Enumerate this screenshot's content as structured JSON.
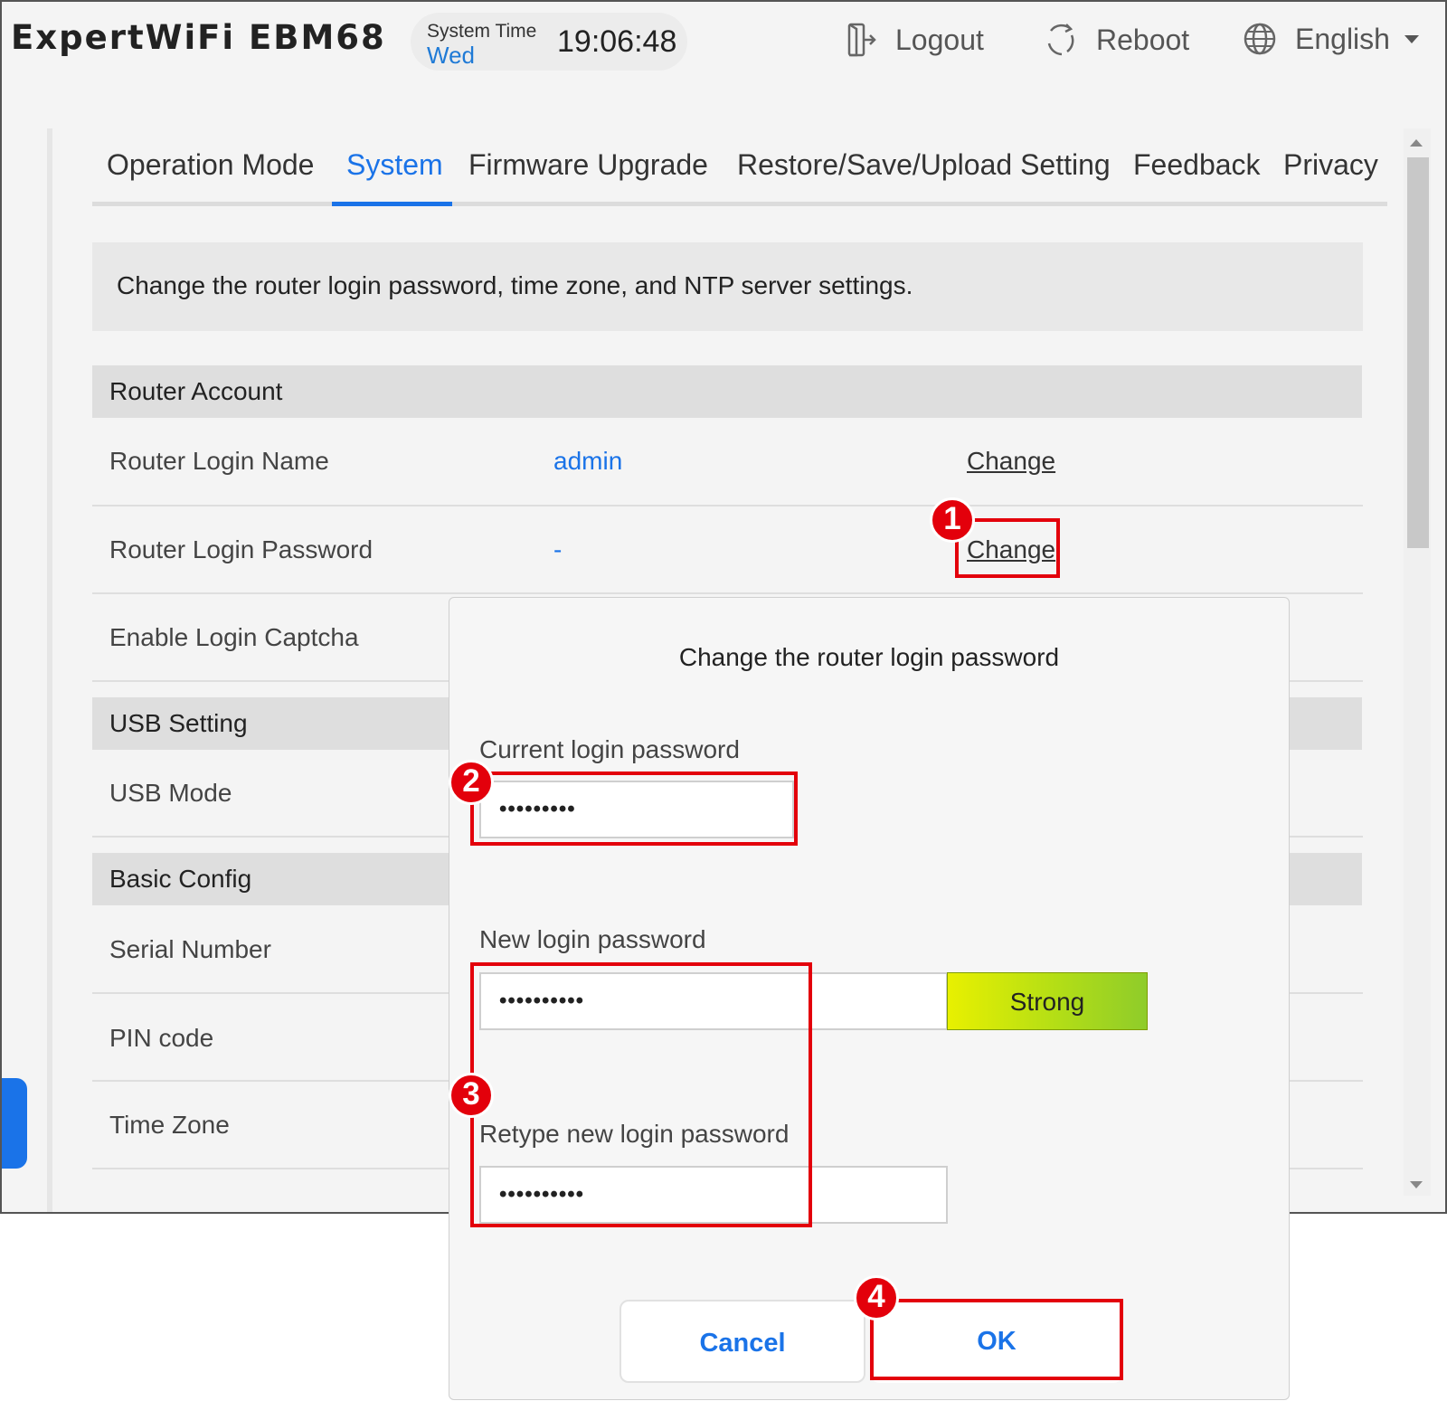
{
  "header": {
    "brand": "ExpertWiFi EBM68",
    "time_label": "System Time",
    "day": "Wed",
    "clock": "19:06:48",
    "logout": "Logout",
    "reboot": "Reboot",
    "language": "English"
  },
  "tabs": [
    {
      "label": "Operation Mode"
    },
    {
      "label": "System"
    },
    {
      "label": "Firmware Upgrade"
    },
    {
      "label": "Restore/Save/Upload Setting"
    },
    {
      "label": "Feedback"
    },
    {
      "label": "Privacy"
    }
  ],
  "description": "Change the router login password, time zone, and NTP server settings.",
  "sections": {
    "router_account": "Router Account",
    "usb_setting": "USB Setting",
    "basic_config": "Basic Config"
  },
  "rows": {
    "login_name": {
      "label": "Router Login Name",
      "value": "admin",
      "action": "Change"
    },
    "login_password": {
      "label": "Router Login Password",
      "value": "-",
      "action": "Change"
    },
    "captcha": {
      "label": "Enable Login Captcha"
    },
    "usb_mode": {
      "label": "USB Mode"
    },
    "serial": {
      "label": "Serial Number"
    },
    "pin": {
      "label": "PIN code"
    },
    "timezone": {
      "label": "Time Zone"
    }
  },
  "modal": {
    "title": "Change the router login password",
    "current_label": "Current login password",
    "current_value": "•••••••••",
    "new_label": "New login password",
    "new_value": "••••••••••",
    "strength": "Strong",
    "retype_label": "Retype new login password",
    "retype_value": "••••••••••",
    "cancel": "Cancel",
    "ok": "OK"
  },
  "annotations": {
    "step1": "1",
    "step2": "2",
    "step3": "3",
    "step4": "4",
    "color": "#e3000b"
  },
  "colors": {
    "accent": "#1a73e8",
    "annotation": "#e3000b",
    "strength_start": "#e8f000",
    "strength_end": "#8fcc2a"
  }
}
